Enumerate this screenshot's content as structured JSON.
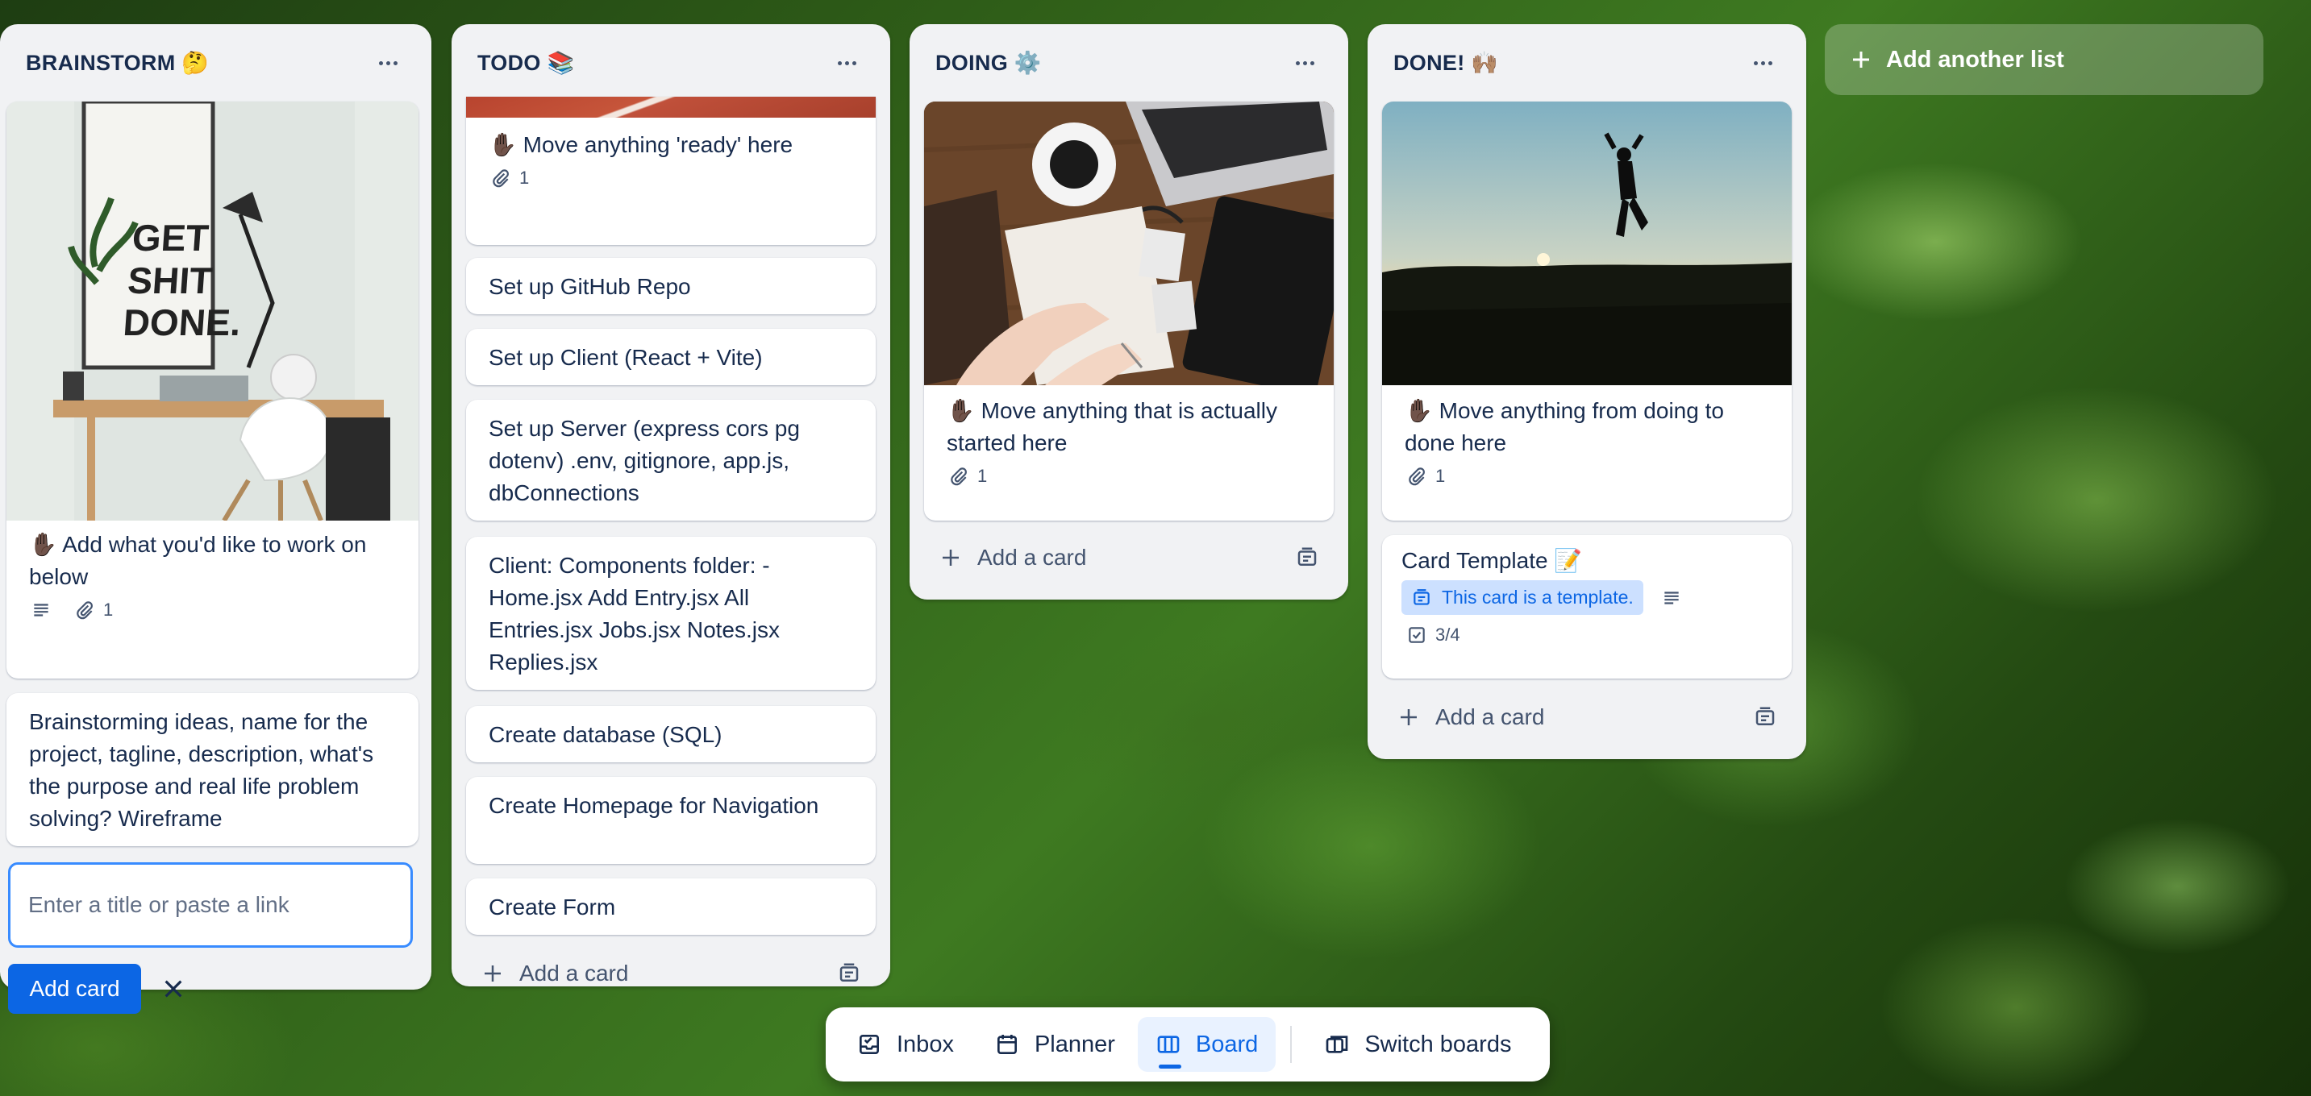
{
  "colors": {
    "accent": "#0c66e4",
    "list_bg": "#f1f2f4",
    "template_badge_bg": "#cce0ff"
  },
  "add_list_label": "Add another list",
  "lists": [
    {
      "title": "BRAINSTORM 🤔",
      "cards": [
        {
          "text": "✋🏿 Add what you'd like to work on below",
          "has_description": true,
          "attachments": "1"
        },
        {
          "text": "Brainstorming ideas, name for the project, tagline, description, what's the purpose and real life problem solving? Wireframe"
        }
      ],
      "composer": {
        "placeholder": "Enter a title or paste a link",
        "value": "",
        "submit_label": "Add card"
      },
      "cover_poster_text": [
        "GET",
        "SHIT",
        "DONE."
      ]
    },
    {
      "title": "TODO 📚",
      "cards": [
        {
          "text": "✋🏿 Move anything 'ready' here",
          "attachments": "1"
        },
        {
          "text": "Set up GitHub Repo"
        },
        {
          "text": "Set up Client (React + Vite)"
        },
        {
          "text": "Set up Server (express cors pg dotenv) .env, gitignore, app.js, dbConnections"
        },
        {
          "text": "Client: Components folder: - Home.jsx Add Entry.jsx All Entries.jsx Jobs.jsx Notes.jsx Replies.jsx"
        },
        {
          "text": "Create database (SQL)"
        },
        {
          "text": "Create Homepage for Navigation"
        },
        {
          "text": "Create Form"
        }
      ],
      "add_card_label": "Add a card"
    },
    {
      "title": "DOING ⚙️",
      "cards": [
        {
          "text": "✋🏿 Move anything that is actually started here",
          "attachments": "1"
        }
      ],
      "add_card_label": "Add a card"
    },
    {
      "title": "DONE! 🙌🏽",
      "cards": [
        {
          "text": "✋🏿 Move anything from doing to done here",
          "attachments": "1"
        },
        {
          "text": "Card Template 📝",
          "template_label": "This card is a template.",
          "has_description": true,
          "checklist": "3/4"
        }
      ],
      "add_card_label": "Add a card"
    }
  ],
  "dock": {
    "items": [
      {
        "label": "Inbox",
        "icon": "inbox-icon"
      },
      {
        "label": "Planner",
        "icon": "calendar-icon"
      },
      {
        "label": "Board",
        "icon": "board-icon",
        "active": true
      },
      {
        "label": "Switch boards",
        "icon": "switch-boards-icon"
      }
    ]
  }
}
